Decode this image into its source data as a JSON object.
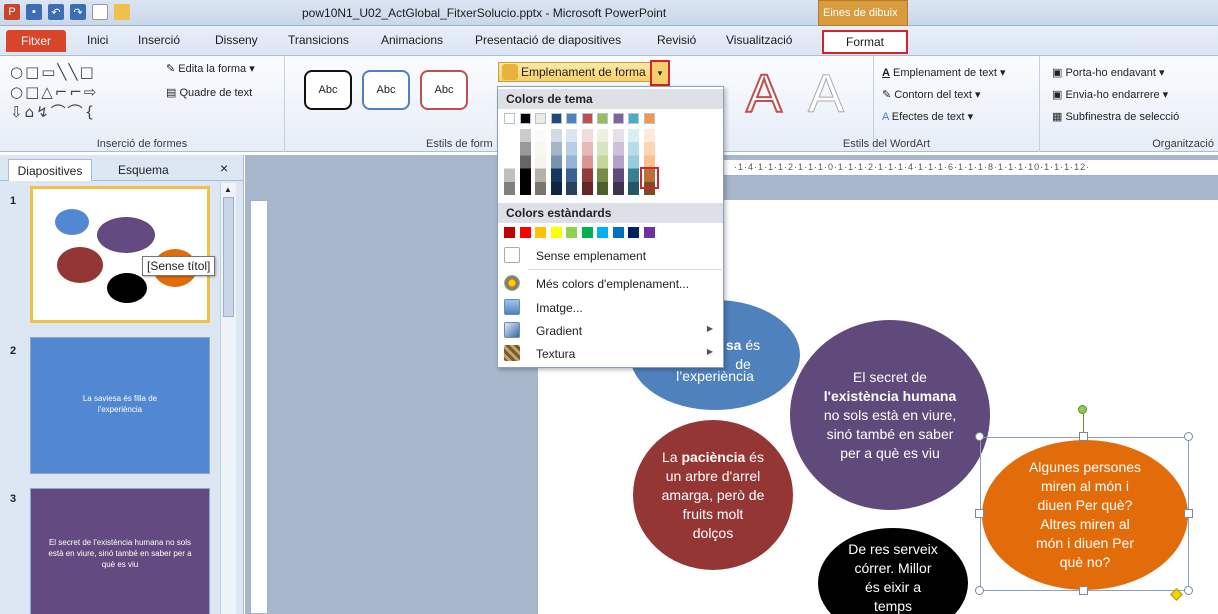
{
  "window": {
    "title": "pow10N1_U02_ActGlobal_FitxerSolucio.pptx - Microsoft PowerPoint",
    "context_tab_title": "Eines de dibuix"
  },
  "tabs": [
    "Fitxer",
    "Inici",
    "Inserció",
    "Disseny",
    "Transicions",
    "Animacions",
    "Presentació de diapositives",
    "Revisió",
    "Visualització",
    "Format"
  ],
  "ribbon": {
    "insert_shapes": {
      "edit_shape": "Edita la forma",
      "text_box": "Quadre de text",
      "label": "Inserció de formes"
    },
    "shape_styles": {
      "abc": "Abc",
      "label": "Estils de form",
      "fill_button": "Emplenament de forma"
    },
    "wordart": {
      "letter": "A",
      "text_fill": "Emplenament de text",
      "text_outline": "Contorn del text",
      "text_effects": "Efectes de text",
      "label": "Estils del WordArt"
    },
    "arrange": {
      "bring_forward": "Porta-ho endavant",
      "send_backward": "Envia-ho endarrere",
      "selection_pane": "Subfinestra de selecció",
      "label": "Organització"
    }
  },
  "fill_menu": {
    "theme_colors": "Colors de tema",
    "standard_colors": "Colors estàndards",
    "no_fill": "Sense emplenament",
    "more_colors": "Més colors d'emplenament...",
    "image": "Imatge...",
    "gradient": "Gradient",
    "texture": "Textura",
    "theme_row": [
      "#ffffff",
      "#000000",
      "#eeece1",
      "#1f497d",
      "#4f81bd",
      "#c0504d",
      "#9bbb59",
      "#8064a2",
      "#4bacc6",
      "#f79646"
    ],
    "standard_row": [
      "#c00000",
      "#ff0000",
      "#ffc000",
      "#ffff00",
      "#92d050",
      "#00b050",
      "#00b0f0",
      "#0070c0",
      "#002060",
      "#7030a0"
    ]
  },
  "panel": {
    "tab_slides": "Diapositives",
    "tab_outline": "Esquema",
    "close": "×",
    "slides": [
      {
        "num": "1"
      },
      {
        "num": "2",
        "text": "La saviesa és filla de l'experiència"
      },
      {
        "num": "3",
        "text": "El secret de l'existència humana no sols està en viure, sinó també en saber per a què es viu"
      }
    ],
    "tooltip": "[Sense títol]"
  },
  "ruler": {
    "h": "·1·4·1·1·1·2·1·1·1·0·1·1·1·2·1·1·1·4·1·1·1·6·1·1·1·8·1·1·1·10·1·1·1·12·"
  },
  "slide": {
    "b1": {
      "pre": "sa",
      "bold": "sa",
      "mid": " és",
      "l2": "de",
      "l3": "l’experiència"
    },
    "b2": {
      "l1": "El secret de",
      "bold": "l'existència humana",
      "l3": "no sols està en viure,",
      "l4": "sinó també en saber",
      "l5": "per a què es viu"
    },
    "b3": {
      "l1a": "La ",
      "bold": "paciència",
      "l1b": " és",
      "l2": "un arbre d'arrel",
      "l3": "amarga, però de",
      "l4": "fruits molt",
      "l5": "dolços"
    },
    "b4": {
      "l1": "De res serveix",
      "l2": "córrer. Millor",
      "l3": "és eixir a",
      "l4": "temps"
    },
    "b5": {
      "l1": "Algunes persones",
      "l2": "miren al món i",
      "l3": "diuen Per què?",
      "l4": "Altres miren al",
      "l5": "món i diuen Per",
      "l6": "què no?"
    }
  }
}
